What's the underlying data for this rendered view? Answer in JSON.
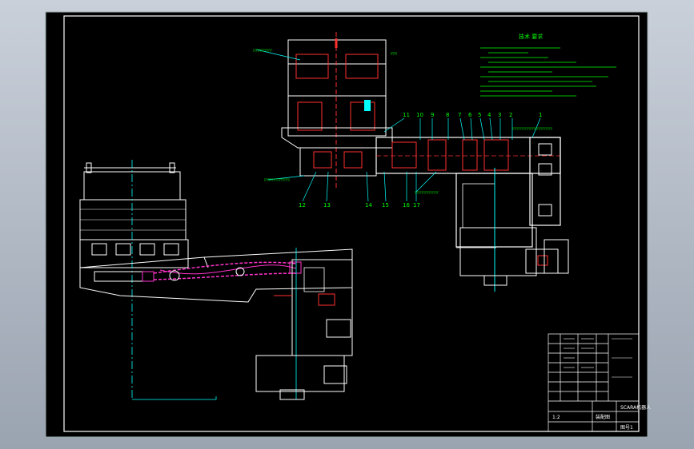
{
  "drawing": {
    "notes_title": "技术 要求",
    "callouts": [
      "1",
      "2",
      "3",
      "4",
      "5",
      "6",
      "7",
      "8",
      "9",
      "10",
      "11",
      "12",
      "13",
      "14",
      "15",
      "16",
      "17"
    ],
    "title_block": {
      "name": "装配图",
      "company": "SCARA机器人",
      "sheet": "图号1",
      "scale": "1:2"
    }
  },
  "colors": {
    "background": "#000000",
    "frame": "#ffffff",
    "notes": "#00ff00",
    "section": "#ff3030",
    "belt": "#ff33cc",
    "centerline": "#00ffff"
  }
}
